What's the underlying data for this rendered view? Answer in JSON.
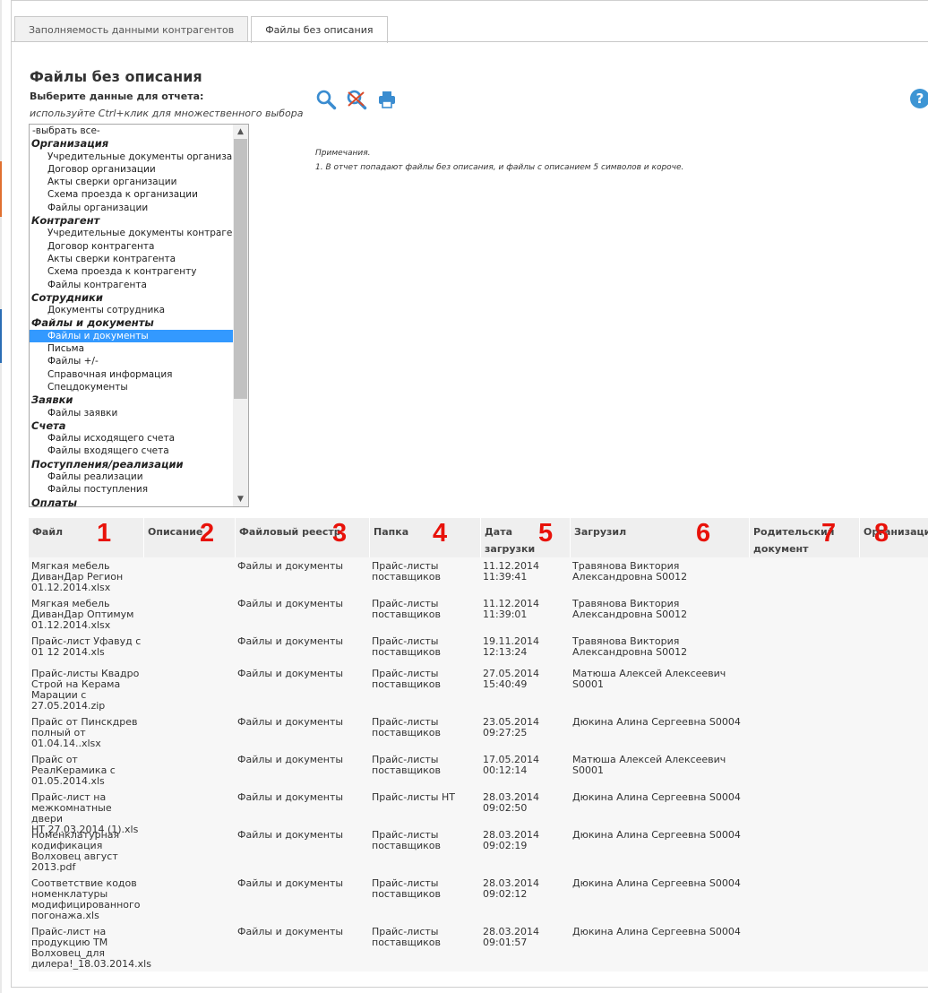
{
  "tabs": [
    {
      "label": "Заполняемость данными контрагентов",
      "active": false
    },
    {
      "label": "Файлы без описания",
      "active": true
    }
  ],
  "page": {
    "title": "Файлы без описания",
    "select_label": "Выберите данные для отчета:",
    "select_hint": "используйте Ctrl+клик для множественного выбора"
  },
  "toolbar": {
    "search_icon": "search-icon",
    "clear_icon": "clear-search-icon",
    "print_icon": "print-icon",
    "help_label": "?"
  },
  "notes": {
    "title": "Примечания.",
    "line1": "1. В отчет попадают файлы без описания, и файлы с описанием 5 символов и короче."
  },
  "listbox": {
    "options": [
      {
        "type": "all",
        "label": "-выбрать все-"
      },
      {
        "type": "group",
        "label": "Организация"
      },
      {
        "type": "item",
        "label": "Учредительные документы организации"
      },
      {
        "type": "item",
        "label": "Договор организации"
      },
      {
        "type": "item",
        "label": "Акты сверки организации"
      },
      {
        "type": "item",
        "label": "Схема проезда к организации"
      },
      {
        "type": "item",
        "label": "Файлы организации"
      },
      {
        "type": "group",
        "label": "Контрагент"
      },
      {
        "type": "item",
        "label": "Учредительные документы контрагента"
      },
      {
        "type": "item",
        "label": "Договор контрагента"
      },
      {
        "type": "item",
        "label": "Акты сверки контрагента"
      },
      {
        "type": "item",
        "label": "Схема проезда к контрагенту"
      },
      {
        "type": "item",
        "label": "Файлы контрагента"
      },
      {
        "type": "group",
        "label": "Сотрудники"
      },
      {
        "type": "item",
        "label": "Документы сотрудника"
      },
      {
        "type": "group",
        "label": "Файлы и документы"
      },
      {
        "type": "item",
        "label": "Файлы и документы",
        "selected": true
      },
      {
        "type": "item",
        "label": "Письма"
      },
      {
        "type": "item",
        "label": "Файлы +/-"
      },
      {
        "type": "item",
        "label": "Справочная информация"
      },
      {
        "type": "item",
        "label": "Спецдокументы"
      },
      {
        "type": "group",
        "label": "Заявки"
      },
      {
        "type": "item",
        "label": "Файлы заявки"
      },
      {
        "type": "group",
        "label": "Счета"
      },
      {
        "type": "item",
        "label": "Файлы исходящего счета"
      },
      {
        "type": "item",
        "label": "Файлы входящего счета"
      },
      {
        "type": "group",
        "label": "Поступления/реализации"
      },
      {
        "type": "item",
        "label": "Файлы реализации"
      },
      {
        "type": "item",
        "label": "Файлы поступления"
      },
      {
        "type": "group",
        "label": "Оплаты"
      }
    ]
  },
  "table": {
    "headers": [
      {
        "label": "Файл",
        "badge": "1"
      },
      {
        "label": "Описание",
        "badge": "2"
      },
      {
        "label": "Файловый реестр",
        "badge": "3"
      },
      {
        "label": "Папка",
        "badge": "4"
      },
      {
        "label": "Дата загрузки",
        "badge": "5"
      },
      {
        "label": "Загрузил",
        "badge": "6"
      },
      {
        "label": "Родительский документ",
        "badge": "7"
      },
      {
        "label": "Организация",
        "badge": "8"
      }
    ],
    "rows": [
      {
        "file": [
          "Мягкая мебель",
          "ДиванДар Регион",
          "01.12.2014.xlsx"
        ],
        "registry": "Файлы и документы",
        "folder": [
          "Прайс-листы",
          "поставщиков"
        ],
        "date": [
          "11.12.2014",
          "11:39:41"
        ],
        "user": [
          "Травянова Виктория",
          "Александровна S0012"
        ]
      },
      {
        "file": [
          "Мягкая мебель",
          "ДиванДар Оптимум",
          "01.12.2014.xlsx"
        ],
        "registry": "Файлы и документы",
        "folder": [
          "Прайс-листы",
          "поставщиков"
        ],
        "date": [
          "11.12.2014",
          "11:39:01"
        ],
        "user": [
          "Травянова Виктория",
          "Александровна S0012"
        ]
      },
      {
        "file": [
          "Прайс-лист Уфавуд с",
          "01 12 2014.xls"
        ],
        "registry": "Файлы и документы",
        "folder": [
          "Прайс-листы",
          "поставщиков"
        ],
        "date": [
          "19.11.2014",
          "12:13:24"
        ],
        "user": [
          "Травянова Виктория",
          "Александровна S0012"
        ]
      },
      {
        "file": [
          "Прайс-листы Квадро",
          "Строй на Керама",
          "Марации с",
          "27.05.2014.zip"
        ],
        "registry": "Файлы и документы",
        "folder": [
          "Прайс-листы",
          "поставщиков"
        ],
        "date": [
          "27.05.2014",
          "15:40:49"
        ],
        "user": [
          "Матюша Алексей Алексеевич",
          "S0001"
        ]
      },
      {
        "file": [
          "Прайс от Пинскдрев",
          "полный от",
          "01.04.14..xlsx"
        ],
        "registry": "Файлы и документы",
        "folder": [
          "Прайс-листы",
          "поставщиков"
        ],
        "date": [
          "23.05.2014",
          "09:27:25"
        ],
        "user": [
          "Дюкина Алина Сергеевна S0004"
        ]
      },
      {
        "file": [
          "Прайс от",
          "РеалКерамика с",
          "01.05.2014.xls"
        ],
        "registry": "Файлы и документы",
        "folder": [
          "Прайс-листы",
          "поставщиков"
        ],
        "date": [
          "17.05.2014",
          "00:12:14"
        ],
        "user": [
          "Матюша Алексей Алексеевич",
          "S0001"
        ]
      },
      {
        "file": [
          "Прайс-лист на",
          "межкомнатные двери",
          "НТ 27.03.2014 (1).xls"
        ],
        "registry": "Файлы и документы",
        "folder": [
          "Прайс-листы НТ"
        ],
        "date": [
          "28.03.2014",
          "09:02:50"
        ],
        "user": [
          "Дюкина Алина Сергеевна S0004"
        ]
      },
      {
        "file": [
          "Номенклатурная",
          "кодификация",
          "Волховец август",
          "2013.pdf"
        ],
        "registry": "Файлы и документы",
        "folder": [
          "Прайс-листы",
          "поставщиков"
        ],
        "date": [
          "28.03.2014",
          "09:02:19"
        ],
        "user": [
          "Дюкина Алина Сергеевна S0004"
        ]
      },
      {
        "file": [
          "Соответствие кодов",
          "номенклатуры",
          "модифицированного",
          "погонажа.xls"
        ],
        "registry": "Файлы и документы",
        "folder": [
          "Прайс-листы",
          "поставщиков"
        ],
        "date": [
          "28.03.2014",
          "09:02:12"
        ],
        "user": [
          "Дюкина Алина Сергеевна S0004"
        ]
      },
      {
        "file": [
          "Прайс-лист на",
          "продукцию ТМ",
          "Волховец_для",
          "дилера!_18.03.2014.xls"
        ],
        "registry": "Файлы и документы",
        "folder": [
          "Прайс-листы",
          "поставщиков"
        ],
        "date": [
          "28.03.2014",
          "09:01:57"
        ],
        "user": [
          "Дюкина Алина Сергеевна S0004"
        ]
      }
    ]
  }
}
